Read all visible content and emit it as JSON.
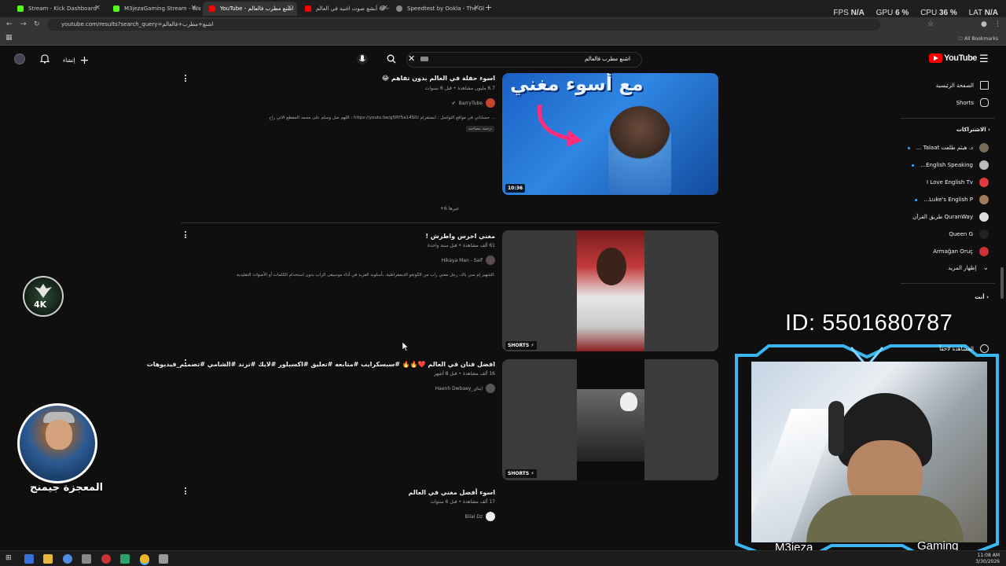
{
  "browser": {
    "tabs": [
      {
        "label": "Stream - Kick Dashboard",
        "color": "#53fc18"
      },
      {
        "label": "M3jezaGaming Stream - Watch",
        "color": "#53fc18"
      },
      {
        "label": "YouTube - اشنع مطرب فالعالم",
        "color": "#ff0000"
      },
      {
        "label": "أبشع صوت اغنية في العالم 😂 -",
        "color": "#ff0000"
      },
      {
        "label": "Speedtest by Ookla - The Glob",
        "color": "#888888"
      }
    ],
    "url": "youtube.com/results?search_query=اشنع+مطرب+فالعالم",
    "all_bookmarks": "All Bookmarks"
  },
  "stats": {
    "fps_label": "FPS",
    "fps": "N/A",
    "gpu_label": "GPU",
    "gpu": "6 %",
    "cpu_label": "CPU",
    "cpu": "36 %",
    "lat_label": "LAT",
    "lat": "N/A"
  },
  "youtube": {
    "logo": "YouTube",
    "search_query": "اشنع مطرب فالعالم",
    "create_label": "إنشاء",
    "sidebar": {
      "home": "الصفحة الرئيسية",
      "shorts": "Shorts",
      "subscriptions_heading": "الاشتراكات",
      "subscriptions": [
        {
          "name": "د. هيثم طلعت Talaat ...",
          "color": "#7a6a5a",
          "dot": true
        },
        {
          "name": "English Speaking...",
          "color": "#bbbbbb",
          "dot": true
        },
        {
          "name": "I Love English Tv",
          "color": "#e23b3b",
          "dot": false
        },
        {
          "name": "Luke's English P...",
          "color": "#a07a5a",
          "dot": true
        },
        {
          "name": "QuranWay طريق القرآن",
          "color": "#dddddd",
          "dot": false
        },
        {
          "name": "Queen G",
          "color": "#222222",
          "dot": false
        },
        {
          "name": "Armağan Oruç",
          "color": "#cc3333",
          "dot": false
        }
      ],
      "show_more": "إظهار المزيد",
      "you_heading": "أنت",
      "watch_later": "المشاهدة لاحقاً"
    },
    "results": [
      {
        "title": "اسوء حفلة في العالم بدون تفاهم 😂",
        "meta": "6.7 مليون مشاهدة • قبل 6 سنوات",
        "channel": "BarryTube",
        "desc": "اللهم صل وسلم على محمد المقطع الاتي راح : https://youtu.be/g5RY5a14SIU حساباتي في مواقع التواصل : انستقرام ...",
        "translated": "ترجمة مصاحبة",
        "duration": "10:36",
        "thumb_text": "مع أسوء مغني"
      },
      {
        "title": "مغني اخرس واطرش !",
        "meta": "61 ألف مشاهدة • قبل سنة واحدة",
        "channel": "Hikaya Man - Saif",
        "desc": "الشهير إم سي ياك، رجل مغني راب من الكونغو الديمقراطية، بأسلوبه الفريد في أداء موسيقى الراب بدون استخدام الكلمات أو الأصوات التقليدية.",
        "badge": "SHORTS"
      },
      {
        "title": "افضل فنان في العالم ❤️🔥🔥 #سبسكرايب #متابعه #تعليق #اكسبلور #لايك #ترند #الشامي #تصميم_فيديوهات",
        "meta": "16 ألف مشاهدة • قبل 8 أشهر",
        "channel": "Haenh Dwbaey_ايناي",
        "badge": "SHORTS"
      },
      {
        "title": "اسوء أفضل مغني في العالم",
        "meta": "17 ألف مشاهدة • قبل 6 سنوات",
        "channel": "Bilal Dz"
      }
    ],
    "more_results": "+6 غيرها"
  },
  "overlay": {
    "id_text": "ID: 5501680787",
    "cam_left": "M3jeza",
    "cam_right": "Gaming",
    "logo_text": "4K",
    "streamer_name": "المعجزة جيمنج"
  },
  "taskbar": {
    "time": "11:08 AM",
    "date": "3/30/2026"
  }
}
